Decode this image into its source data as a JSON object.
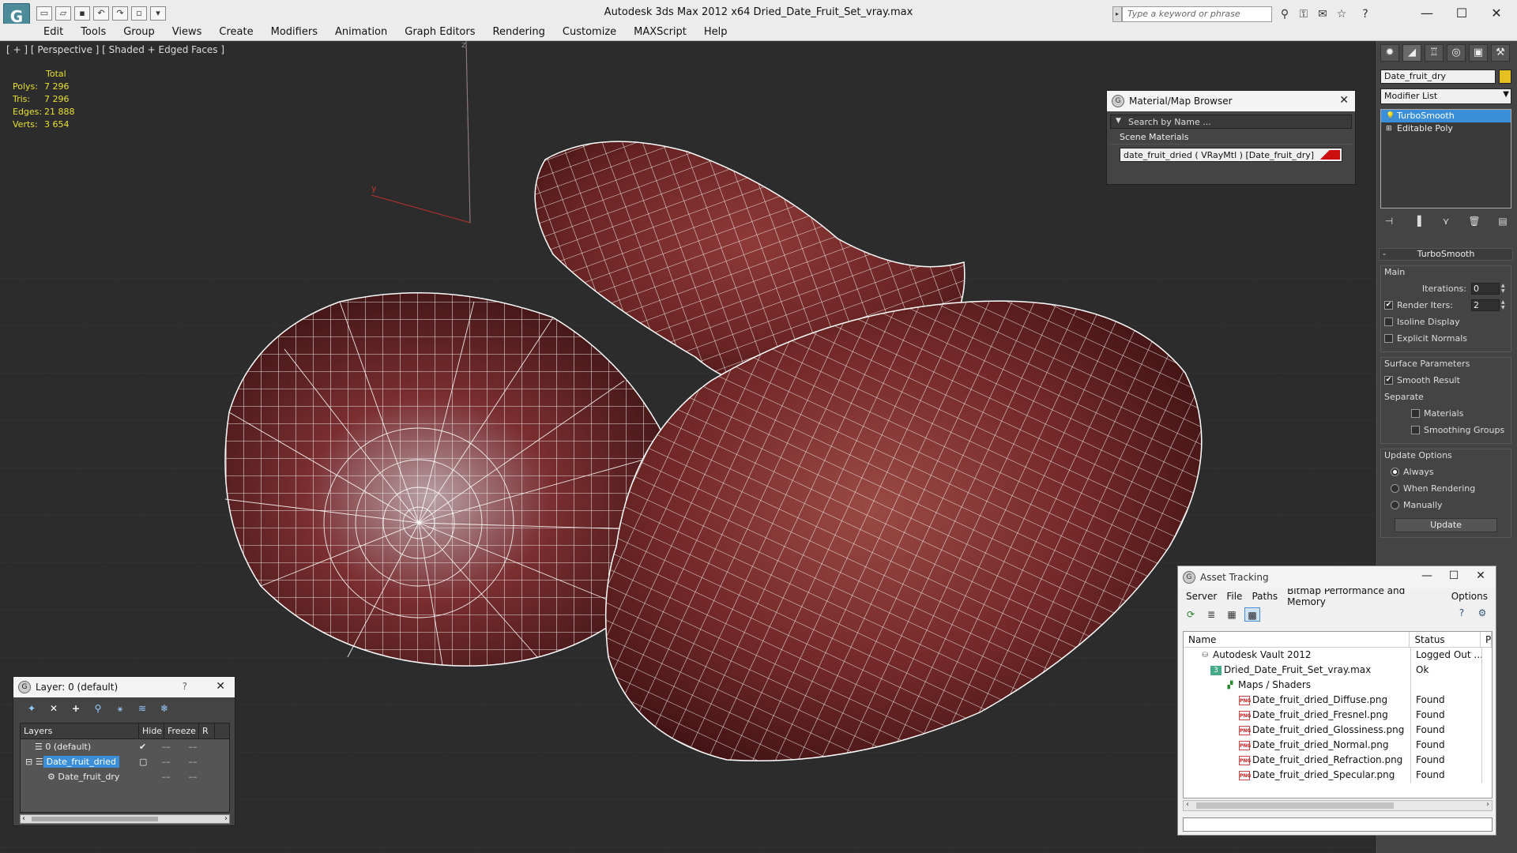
{
  "titlebar": {
    "logo": "G",
    "title": "Autodesk 3ds Max  2012 x64     Dried_Date_Fruit_Set_vray.max",
    "search_placeholder": "Type a keyword or phrase",
    "minimize": "—",
    "maximize": "☐",
    "close": "✕"
  },
  "menu": [
    "Edit",
    "Tools",
    "Group",
    "Views",
    "Create",
    "Modifiers",
    "Animation",
    "Graph Editors",
    "Rendering",
    "Customize",
    "MAXScript",
    "Help"
  ],
  "viewport": {
    "label": "[ + ] [ Perspective ] [ Shaded + Edged Faces ]",
    "stats": {
      "header": "Total",
      "polys_label": "Polys:",
      "polys": "7 296",
      "tris_label": "Tris:",
      "tris": "7 296",
      "edges_label": "Edges:",
      "edges": "21 888",
      "verts_label": "Verts:",
      "verts": "3 654"
    },
    "axis_y": "y",
    "axis_z": "z"
  },
  "command_panel": {
    "object_name": "Date_fruit_dry",
    "object_color": "#e6c020",
    "modifier_list": "Modifier List",
    "stack": [
      {
        "label": "TurboSmooth",
        "selected": true
      },
      {
        "label": "Editable Poly",
        "selected": false
      }
    ],
    "turbosmooth": {
      "title": "TurboSmooth",
      "main_title": "Main",
      "iterations_label": "Iterations:",
      "iterations": "0",
      "render_iters_label": "Render Iters:",
      "render_iters": "2",
      "render_iters_checked": true,
      "isoline_label": "Isoline Display",
      "explicit_normals_label": "Explicit Normals",
      "surface_title": "Surface Parameters",
      "smooth_result_label": "Smooth Result",
      "separate_label": "Separate",
      "materials_label": "Materials",
      "smoothing_groups_label": "Smoothing Groups",
      "update_title": "Update Options",
      "always_label": "Always",
      "when_rendering_label": "When Rendering",
      "manually_label": "Manually",
      "update_button": "Update"
    }
  },
  "material_browser": {
    "title": "Material/Map Browser",
    "search_placeholder": "Search by Name ...",
    "section": "Scene Materials",
    "item": "date_fruit_dried  ( VRayMtl ) [Date_fruit_dry]"
  },
  "asset_tracking": {
    "title": "Asset Tracking",
    "menu": [
      "Server",
      "File",
      "Paths",
      "Bitmap Performance and Memory",
      "Options"
    ],
    "columns": [
      "Name",
      "Status",
      "P"
    ],
    "rows": [
      {
        "name": "Autodesk Vault 2012",
        "status": "Logged Out ...",
        "indent": 1,
        "icon": "vault"
      },
      {
        "name": "Dried_Date_Fruit_Set_vray.max",
        "status": "Ok",
        "indent": 2,
        "icon": "max"
      },
      {
        "name": "Maps / Shaders",
        "status": "",
        "indent": 3,
        "icon": "maps"
      },
      {
        "name": "Date_fruit_dried_Diffuse.png",
        "status": "Found",
        "indent": 4,
        "icon": "png"
      },
      {
        "name": "Date_fruit_dried_Fresnel.png",
        "status": "Found",
        "indent": 4,
        "icon": "png"
      },
      {
        "name": "Date_fruit_dried_Glossiness.png",
        "status": "Found",
        "indent": 4,
        "icon": "png"
      },
      {
        "name": "Date_fruit_dried_Normal.png",
        "status": "Found",
        "indent": 4,
        "icon": "png"
      },
      {
        "name": "Date_fruit_dried_Refraction.png",
        "status": "Found",
        "indent": 4,
        "icon": "png"
      },
      {
        "name": "Date_fruit_dried_Specular.png",
        "status": "Found",
        "indent": 4,
        "icon": "png"
      }
    ]
  },
  "layer_dialog": {
    "title": "Layer: 0 (default)",
    "help": "?",
    "columns": [
      "Layers",
      "Hide",
      "Freeze",
      "R"
    ],
    "rows": [
      {
        "name": "0 (default)",
        "indent": 1,
        "selected": false,
        "check": "✔"
      },
      {
        "name": "Date_fruit_dried",
        "indent": 1,
        "selected": true,
        "check": ""
      },
      {
        "name": "Date_fruit_dry",
        "indent": 2,
        "selected": false,
        "check": ""
      }
    ]
  }
}
